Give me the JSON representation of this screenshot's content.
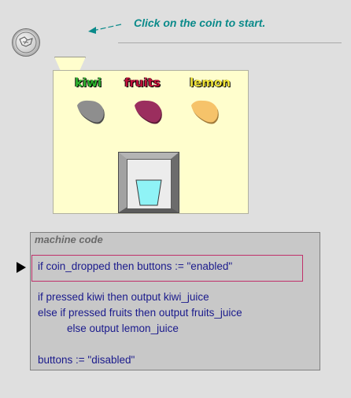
{
  "instruction": {
    "text": "Click on the coin to start."
  },
  "machine": {
    "buttons": [
      {
        "label": "kiwi",
        "color": "#8e8e8e"
      },
      {
        "label": "fruits",
        "color": "#9b2e5e"
      },
      {
        "label": "lemon",
        "color": "#f6c36a"
      }
    ],
    "cup_color": "#8ff3f6"
  },
  "code": {
    "title": "machine code",
    "lines": [
      "if coin_dropped then buttons := \"enabled\"",
      "if pressed kiwi then output kiwi_juice",
      "else if pressed fruits then output fruits_juice",
      "else output lemon_juice",
      "buttons := \"disabled\""
    ],
    "highlight_color": "#c0306a",
    "text_color": "#1a1a8c"
  },
  "colors": {
    "background": "#dfdfdf",
    "machine_body": "#fffecd",
    "instruction_text": "#0a8a8a"
  }
}
